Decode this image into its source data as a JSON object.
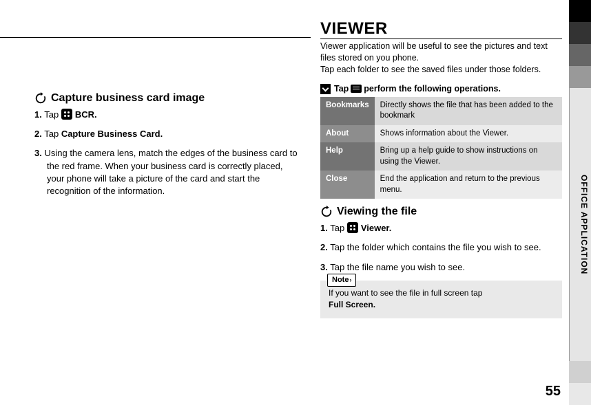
{
  "left": {
    "heading": "Capture business card image",
    "steps": [
      {
        "num": "1.",
        "pre": "Tap ",
        "post": " ➔ ",
        "bold": "BCR."
      },
      {
        "num": "2.",
        "pre": "Tap ",
        "bold": "Capture Business Card."
      },
      {
        "num": "3.",
        "text": "Using the camera lens, match the edges of the business card to the red frame. When your business card is correctly placed, your phone will take a picture of the card and start the recognition of the information."
      }
    ]
  },
  "right": {
    "title": "VIEWER",
    "intro1": "Viewer application will be useful to see the pictures and text files stored on you phone.",
    "intro2": "Tap each folder to see the saved files under those folders.",
    "ops_head_pre": "Tap",
    "ops_head_post": "perform the following operations.",
    "ops": [
      {
        "k": "Bookmarks",
        "v": "Directly shows the file that has been added to the bookmark"
      },
      {
        "k": "About",
        "v": "Shows information about the Viewer."
      },
      {
        "k": "Help",
        "v": "Bring up a help guide to show instructions on using the Viewer."
      },
      {
        "k": "Close",
        "v": "End the application and return to the previous menu."
      }
    ],
    "view_heading": "Viewing the file",
    "vsteps": {
      "s1_pre": "Tap ",
      "s1_post": " ➔ ",
      "s1_bold": "Viewer.",
      "s2": "Tap the folder which contains the file you wish to see.",
      "s3": "Tap the file name you wish to see."
    },
    "note_label": "Note",
    "note_text_a": "If you want to see the file in full screen tap",
    "note_text_b": "Full Screen."
  },
  "sidebar_label": "OFFICE APPLICATION",
  "page_number": "55"
}
